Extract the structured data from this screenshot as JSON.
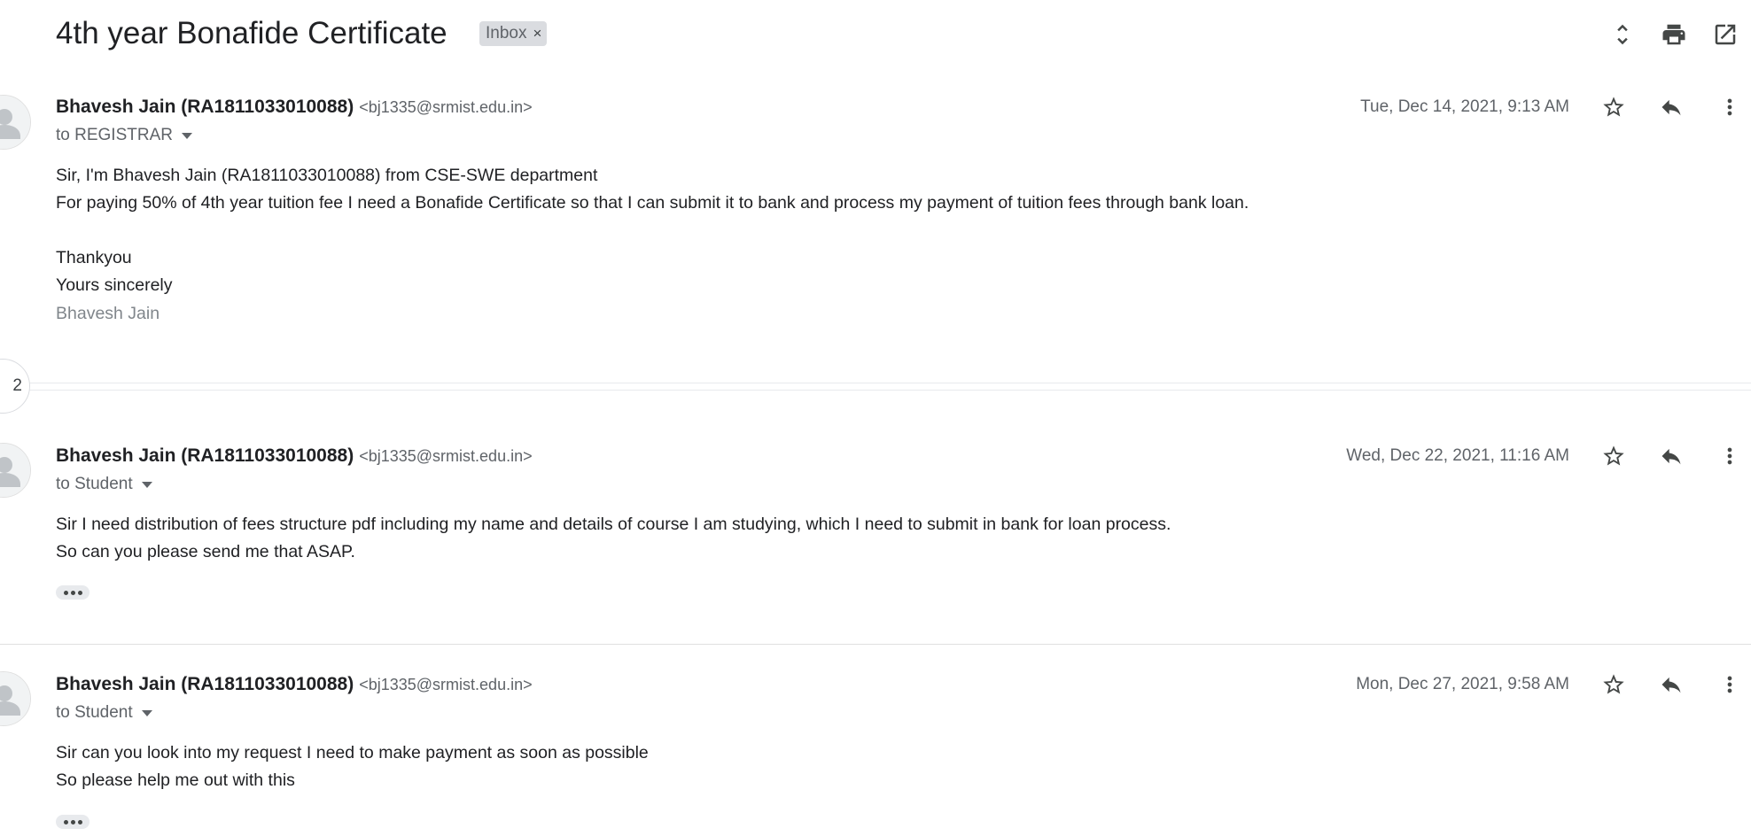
{
  "thread": {
    "subject": "4th year Bonafide Certificate",
    "label_chip": "Inbox",
    "label_remove": "×",
    "collapsed_count": "2"
  },
  "header_icons": [
    "expand-collapse-icon",
    "print-icon",
    "open-in-new-window-icon"
  ],
  "messages": [
    {
      "sender_name": "Bhavesh Jain (RA1811033010088)",
      "sender_email": "<bj1335@srmist.edu.in>",
      "to": "to REGISTRAR",
      "date": "Tue, Dec 14, 2021, 9:13 AM",
      "body": [
        "Sir, I'm Bhavesh Jain (RA1811033010088) from CSE-SWE department",
        "For paying 50% of 4th year tuition fee I need a Bonafide Certificate so that I can submit it to bank and process my payment of tuition fees through bank loan.",
        "",
        "Thankyou",
        "Yours sincerely"
      ],
      "signature": "Bhavesh Jain"
    },
    {
      "sender_name": "Bhavesh Jain (RA1811033010088)",
      "sender_email": "<bj1335@srmist.edu.in>",
      "to": "to Student",
      "date": "Wed, Dec 22, 2021, 11:16 AM",
      "body": [
        "Sir I need distribution of fees structure pdf including my name and details of course I am studying, which I need to submit in bank for loan process.",
        "So can you please send me that ASAP."
      ]
    },
    {
      "sender_name": "Bhavesh Jain (RA1811033010088)",
      "sender_email": "<bj1335@srmist.edu.in>",
      "to": "to Student",
      "date": "Mon, Dec 27, 2021, 9:58 AM",
      "body": [
        "Sir can you look into my request I need to make payment as soon as possible",
        "So please help me out with this"
      ]
    }
  ],
  "message_icons": [
    "star-icon",
    "reply-icon",
    "more-vert-icon"
  ],
  "colors": {
    "text": "#202124",
    "secondary": "#5f6368",
    "chip_bg": "#dadce0"
  }
}
